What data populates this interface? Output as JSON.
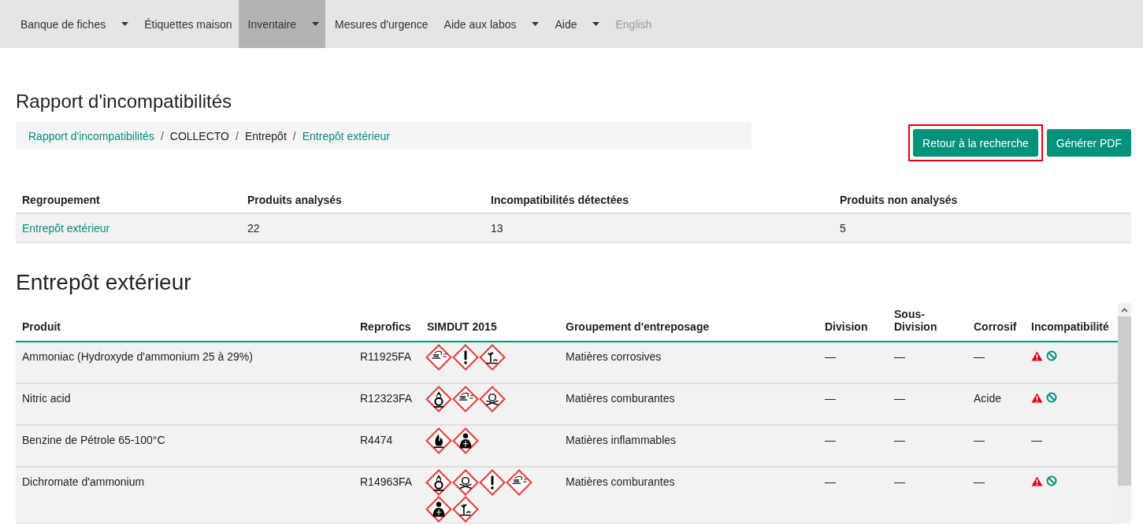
{
  "nav": [
    {
      "label": "Banque de fiches",
      "dropdown": true,
      "selected": false,
      "disabled": false
    },
    {
      "label": "Étiquettes maison",
      "dropdown": false,
      "selected": false,
      "disabled": false
    },
    {
      "label": "Inventaire",
      "dropdown": true,
      "selected": true,
      "disabled": false
    },
    {
      "label": "Mesures d'urgence",
      "dropdown": false,
      "selected": false,
      "disabled": false
    },
    {
      "label": "Aide aux labos",
      "dropdown": true,
      "selected": false,
      "disabled": false
    },
    {
      "label": "Aide",
      "dropdown": true,
      "selected": false,
      "disabled": false
    },
    {
      "label": "English",
      "dropdown": false,
      "selected": false,
      "disabled": true
    }
  ],
  "page_title": "Rapport d'incompatibilités",
  "breadcrumb": [
    {
      "label": "Rapport d'incompatibilités",
      "link": true
    },
    {
      "label": "COLLECTO",
      "link": false
    },
    {
      "label": "Entrepôt",
      "link": false
    },
    {
      "label": "Entrepôt extérieur",
      "link": true
    }
  ],
  "breadcrumb_separator": "/",
  "buttons": [
    {
      "label": "Retour à la recherche",
      "highlighted": true
    },
    {
      "label": "Générer PDF",
      "highlighted": false
    }
  ],
  "summary": {
    "columns": [
      "Regroupement",
      "Produits analysés",
      "Incompatibilités détectées",
      "Produits non analysés"
    ],
    "rows": [
      {
        "group": "Entrepôt extérieur",
        "analyzed": "22",
        "incompatibilities": "13",
        "not_analyzed": "5"
      }
    ]
  },
  "section_title": "Entrepôt extérieur",
  "table": {
    "columns": [
      "Produit",
      "Reprofics",
      "SIMDUT 2015",
      "Groupement d'entreposage",
      "Division",
      "Sous-Division",
      "Corrosif",
      "Incompatibilité"
    ],
    "rows": [
      {
        "product": "Ammoniac (Hydroxyde d'ammonium 25 à 29%)",
        "reprofics": "R11925FA",
        "pictograms": [
          {
            "kind": "corrosion"
          },
          {
            "kind": "exclamation"
          },
          {
            "kind": "environment"
          }
        ],
        "storage": "Matières corrosives",
        "division": "—",
        "subdivision": "—",
        "corrosive": "—",
        "incompatibility": {
          "flagged": true
        }
      },
      {
        "product": "Nitric acid",
        "reprofics": "R12323FA",
        "pictograms": [
          {
            "kind": "oxidizer"
          },
          {
            "kind": "corrosion"
          },
          {
            "kind": "skull"
          }
        ],
        "storage": "Matières comburantes",
        "division": "—",
        "subdivision": "—",
        "corrosive": "Acide",
        "incompatibility": {
          "flagged": true
        }
      },
      {
        "product": "Benzine de Pétrole 65-100°C",
        "reprofics": "R4474",
        "pictograms": [
          {
            "kind": "flame"
          },
          {
            "kind": "health"
          }
        ],
        "storage": "Matières inflammables",
        "division": "—",
        "subdivision": "—",
        "corrosive": "—",
        "incompatibility": {
          "flagged": false,
          "text": "—"
        }
      },
      {
        "product": "Dichromate d'ammonium",
        "reprofics": "R14963FA",
        "pictograms": [
          {
            "kind": "oxidizer"
          },
          {
            "kind": "skull"
          },
          {
            "kind": "exclamation"
          },
          {
            "kind": "corrosion"
          },
          {
            "kind": "health"
          },
          {
            "kind": "environment"
          }
        ],
        "storage": "Matières comburantes",
        "division": "—",
        "subdivision": "—",
        "corrosive": "—",
        "incompatibility": {
          "flagged": true
        }
      }
    ]
  }
}
